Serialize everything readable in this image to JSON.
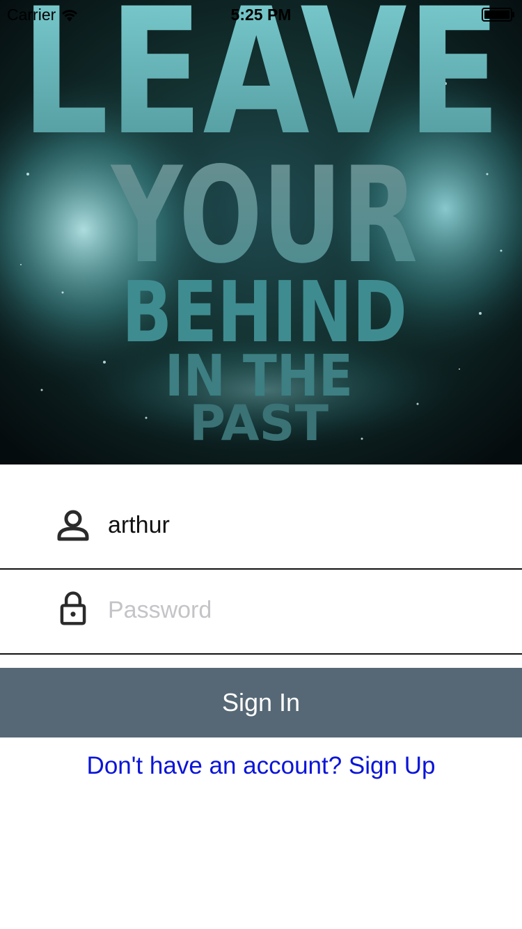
{
  "status_bar": {
    "carrier": "Carrier",
    "time": "5:25 PM"
  },
  "hero": {
    "lines": [
      "LEAVE",
      "YOUR",
      "BEHIND",
      "IN THE",
      "PAST"
    ],
    "colors": {
      "background": "#0b1619",
      "glow": "#7fd3d8",
      "text": "#5ba6a9"
    }
  },
  "login": {
    "username_value": "arthur",
    "password_placeholder": "Password",
    "signin_label": "Sign In",
    "signup_link_label": "Don't have an account? Sign Up"
  },
  "icons": {
    "username": "person-icon",
    "password": "lock-icon"
  },
  "colors": {
    "signin_button": "#566876",
    "link": "#0a14d8",
    "divider": "#111111",
    "placeholder": "#c4c4c8"
  }
}
